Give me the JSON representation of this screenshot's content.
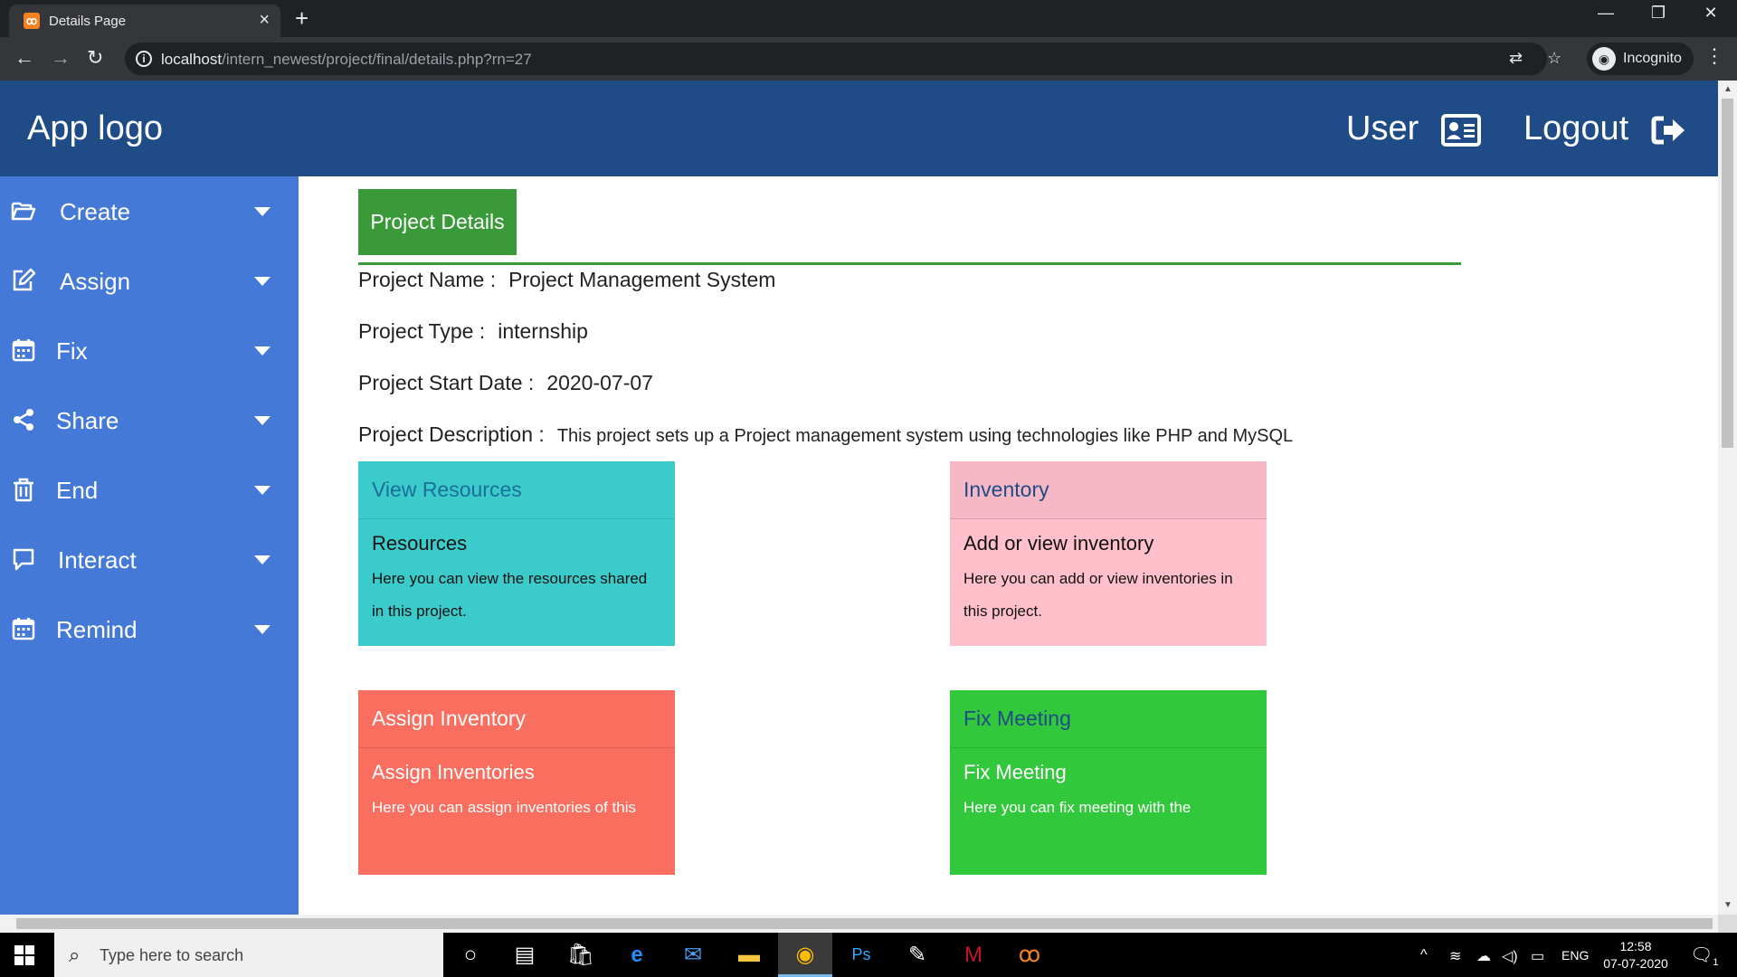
{
  "browser": {
    "tab_title": "Details Page",
    "url_host": "localhost",
    "url_path": "/intern_newest/project/final/details.php?rn=27",
    "profile_label": "Incognito"
  },
  "navbar": {
    "logo": "App logo",
    "user_label": "User",
    "logout_label": "Logout"
  },
  "sidebar": {
    "items": [
      {
        "label": "Create",
        "icon": "folder-open-icon"
      },
      {
        "label": "Assign",
        "icon": "edit-icon"
      },
      {
        "label": "Fix",
        "icon": "calendar-icon"
      },
      {
        "label": "Share",
        "icon": "share-icon"
      },
      {
        "label": "End",
        "icon": "trash-icon"
      },
      {
        "label": "Interact",
        "icon": "comment-icon"
      },
      {
        "label": "Remind",
        "icon": "calendar-icon"
      }
    ]
  },
  "details": {
    "header_button": "Project Details",
    "name_label": "Project Name :",
    "name_value": "Project Management System",
    "type_label": "Project Type :",
    "type_value": "internship",
    "start_label": "Project Start Date :",
    "start_value": "2020-07-07",
    "desc_label": "Project Description :",
    "desc_value": "This project sets up a Project management system using technologies like PHP and MySQL"
  },
  "cards": [
    {
      "header": "View Resources",
      "title": "Resources",
      "text": "Here you can view the resources shared in this project.",
      "color": "#3ccbcb",
      "header_color": "#1a6f9a"
    },
    {
      "header": "Inventory",
      "title": "Add or view inventory",
      "text": "Here you can add or view inventories in this project.",
      "color": "#ffc0cb",
      "header_color": "#1f4c86"
    },
    {
      "header": "Assign Inventory",
      "title": "Assign Inventories",
      "text": "Here you can assign inventories of this",
      "color": "#f96e5f",
      "header_color": "#ffffff"
    },
    {
      "header": "Fix Meeting",
      "title": "Fix Meeting",
      "text": "Here you can fix meeting with the",
      "color": "#32c83c",
      "header_color": "#1f4c86"
    }
  ],
  "taskbar": {
    "search_placeholder": "Type here to search",
    "language": "ENG",
    "time": "12:58",
    "date": "07-07-2020",
    "notification_count": "1"
  }
}
